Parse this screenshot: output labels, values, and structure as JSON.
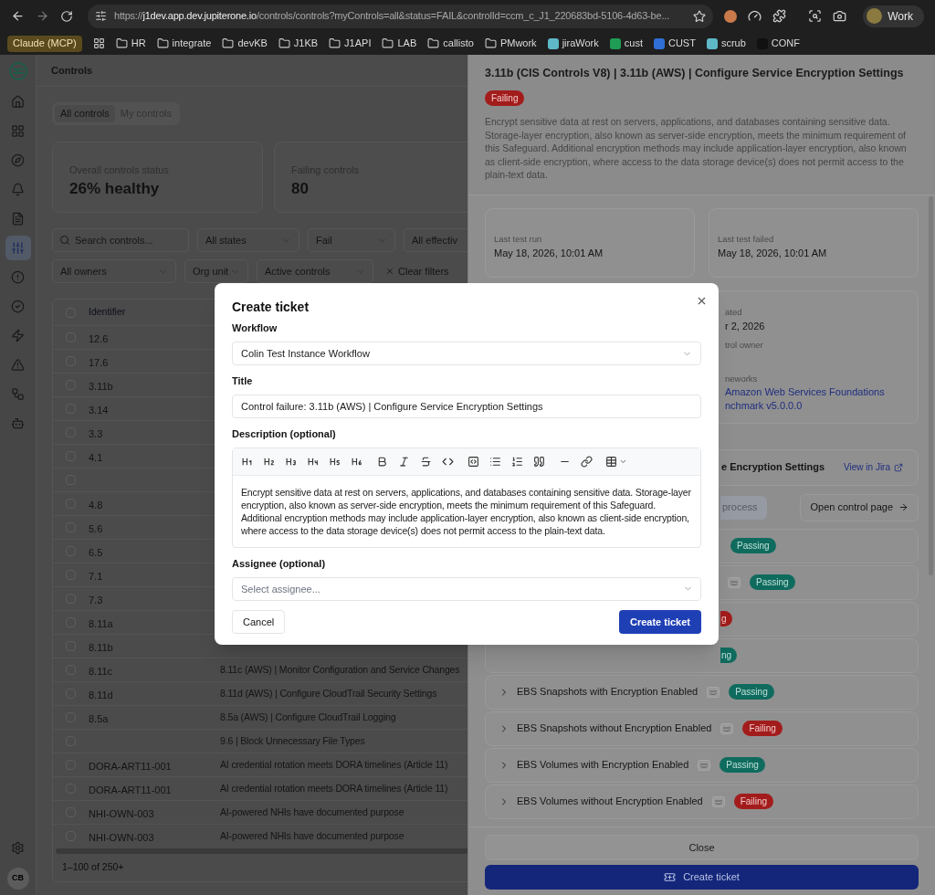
{
  "browser": {
    "url_prefix": "https://",
    "url_host": "j1dev.app.dev.jupiterone.io",
    "url_path": "/controls/controls?myControls=all&status=FAIL&controlId=ccm_c_J1_220683bd-5106-4d63-be...",
    "profile": "Work",
    "bookmarks": [
      {
        "kind": "tag",
        "label": "Claude (MCP)"
      },
      {
        "kind": "apps"
      },
      {
        "kind": "folder",
        "label": "HR"
      },
      {
        "kind": "folder",
        "label": "integrate"
      },
      {
        "kind": "folder",
        "label": "devKB"
      },
      {
        "kind": "folder",
        "label": "J1KB"
      },
      {
        "kind": "folder",
        "label": "J1API"
      },
      {
        "kind": "folder",
        "label": "LAB"
      },
      {
        "kind": "folder",
        "label": "callisto"
      },
      {
        "kind": "folder",
        "label": "PMwork"
      },
      {
        "kind": "site",
        "label": "jiraWork",
        "color": "#5fb8c8"
      },
      {
        "kind": "site",
        "label": "cust",
        "color": "#1f9d55"
      },
      {
        "kind": "site",
        "label": "CUST",
        "color": "#2f6fd6"
      },
      {
        "kind": "site",
        "label": "scrub",
        "color": "#5fb8c8"
      },
      {
        "kind": "site",
        "label": "CONF",
        "color": "#111111"
      }
    ]
  },
  "sidebar": {
    "items": [
      {
        "selected": false
      },
      {
        "selected": false
      },
      {
        "selected": false
      },
      {
        "selected": false
      },
      {
        "selected": false
      },
      {
        "selected": true
      },
      {
        "selected": false
      },
      {
        "selected": false
      },
      {
        "selected": false
      },
      {
        "selected": false
      },
      {
        "selected": false
      },
      {
        "selected": false
      }
    ],
    "avatar": "CB"
  },
  "main": {
    "title": "Controls",
    "tabs": [
      {
        "label": "All controls",
        "selected": true
      },
      {
        "label": "My controls",
        "selected": false
      }
    ],
    "stats": [
      {
        "label": "Overall controls status",
        "value": "26% healthy"
      },
      {
        "label": "Failing controls",
        "value": "80"
      }
    ],
    "search": {
      "placeholder": "Search controls..."
    },
    "filters_row1": [
      {
        "label": "All states"
      },
      {
        "label": "Fail"
      },
      {
        "label": "All effectiv"
      }
    ],
    "filters_row2": [
      {
        "label": "All owners"
      },
      {
        "label": "Org unit"
      },
      {
        "label": "Active controls"
      }
    ],
    "clear_filters": "Clear filters",
    "table": {
      "columns": [
        "Identifier"
      ],
      "header_checked": false,
      "rows": [
        {
          "identifier": "12.6",
          "checked": false
        },
        {
          "identifier": "17.6",
          "checked": false
        },
        {
          "identifier": "3.11b",
          "checked": false
        },
        {
          "identifier": "3.14",
          "checked": false
        },
        {
          "identifier": "3.3",
          "checked": false
        },
        {
          "identifier": "4.1",
          "checked": false
        },
        {
          "checked": false
        },
        {
          "identifier": "4.8",
          "checked": false
        },
        {
          "identifier": "5.6",
          "checked": false
        },
        {
          "identifier": "6.5",
          "checked": false
        },
        {
          "identifier": "7.1",
          "checked": false
        },
        {
          "identifier": "7.3",
          "checked": false
        },
        {
          "identifier": "8.11a",
          "checked": false
        },
        {
          "identifier": "8.11b",
          "checked": false
        },
        {
          "identifier": "8.11c",
          "name": "8.11c (AWS) | Monitor Configuration and Service Changes",
          "checked": false
        },
        {
          "identifier": "8.11d",
          "name": "8.11d (AWS) | Configure CloudTrail Security Settings",
          "checked": false
        },
        {
          "identifier": "8.5a",
          "name": "8.5a (AWS) | Configure CloudTrail Logging",
          "checked": false
        },
        {
          "name": "9.6 | Block Unnecessary File Types",
          "checked": false
        },
        {
          "identifier": "DORA-ART11-001",
          "name": "AI credential rotation meets DORA timelines (Article 11)",
          "checked": false
        },
        {
          "identifier": "DORA-ART11-001",
          "name": "AI credential rotation meets DORA timelines (Article 11)",
          "checked": false
        },
        {
          "identifier": "NHI-OWN-003",
          "name": "AI-powered NHIs have documented purpose",
          "checked": false
        },
        {
          "identifier": "NHI-OWN-003",
          "name": "AI-powered NHIs have documented purpose",
          "checked": false
        }
      ],
      "pagination": "1–100 of 250+"
    }
  },
  "drawer": {
    "title": "3.11b (CIS Controls V8) | 3.11b (AWS) | Configure Service Encryption Settings",
    "status": {
      "label": "Failing",
      "kind": "failing"
    },
    "description": "Encrypt sensitive data at rest on servers, applications, and databases containing sensitive data. Storage-layer encryption, also known as server-side encryption, meets the minimum requirement of this Safeguard. Additional encryption methods may include application-layer encryption, also known as client-side encryption, where access to the data storage device(s) does not permit access to the plain-text data.",
    "meta": [
      {
        "label": "Last test run",
        "value": "May 18, 2026, 10:01 AM"
      },
      {
        "label": "Last test failed",
        "value": "May 18, 2026, 10:01 AM"
      }
    ],
    "details": {
      "updated_label": "ated",
      "updated_value": "r 2, 2026",
      "owner_label": "trol owner",
      "frameworks_label": "neworks",
      "framework_link_lines": [
        "Amazon Web Services Foundations",
        "nchmark v5.0.0.0"
      ]
    },
    "ticket": {
      "title": "e Encryption Settings",
      "link": "View in Jira"
    },
    "process_chip": "process",
    "open_page": "Open control page",
    "tests": [
      {
        "badge": "Passing",
        "kind": "passing",
        "aws": false,
        "partial": false
      },
      {
        "badge": "Passing",
        "kind": "passing",
        "aws": true,
        "partial": false
      },
      {
        "badge": "g",
        "kind": "failing",
        "aws": false,
        "partial": true
      },
      {
        "badge": "ng",
        "kind": "passing",
        "aws": false,
        "partial": true
      },
      {
        "name": "EBS Snapshots with Encryption Enabled",
        "badge": "Passing",
        "kind": "passing",
        "aws": true,
        "partial": false
      },
      {
        "name": "EBS Snapshots without Encryption Enabled",
        "badge": "Failing",
        "kind": "failing",
        "aws": true,
        "partial": false
      },
      {
        "name": "EBS Volumes with Encryption Enabled",
        "badge": "Passing",
        "kind": "passing",
        "aws": true,
        "partial": false
      },
      {
        "name": "EBS Volumes without Encryption Enabled",
        "badge": "Failing",
        "kind": "failing",
        "aws": true,
        "partial": false
      }
    ],
    "footer": {
      "close": "Close",
      "create": "Create ticket"
    }
  },
  "modal": {
    "title": "Create ticket",
    "workflow": {
      "label": "Workflow",
      "value": "Colin Test Instance Workflow"
    },
    "title_field": {
      "label": "Title",
      "value": "Control failure: 3.11b (AWS) | Configure Service Encryption Settings"
    },
    "description": {
      "label": "Description (optional)",
      "value": "Encrypt sensitive data at rest on servers, applications, and databases containing sensitive data. Storage-layer encryption, also known as server-side encryption, meets the minimum requirement of this Safeguard. Additional encryption methods may include application-layer encryption, also known as client-side encryption, where access to the data storage device(s) does not permit access to the plain-text data."
    },
    "assignee": {
      "label": "Assignee (optional)",
      "placeholder": "Select assignee..."
    },
    "cancel": "Cancel",
    "submit": "Create ticket"
  }
}
